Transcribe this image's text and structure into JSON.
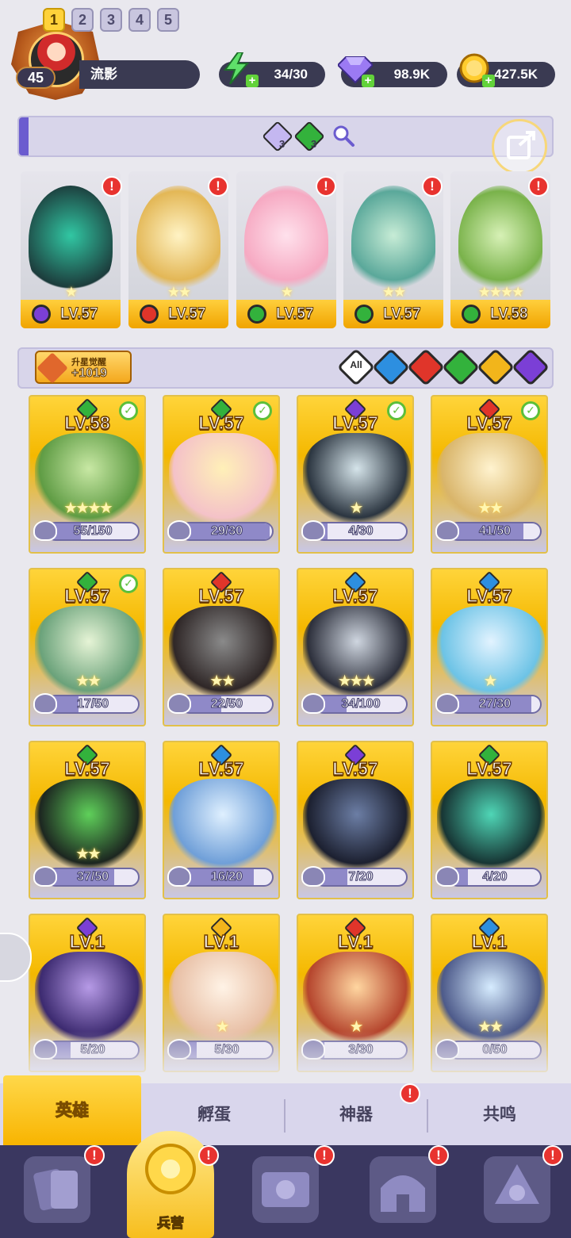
{
  "player": {
    "level": "45",
    "name": "流影"
  },
  "resources": {
    "energy": "34/30",
    "gems": "98.9K",
    "gold": "427.5K"
  },
  "team_tabs": [
    "1",
    "2",
    "3",
    "4",
    "5"
  ],
  "team_tools": {
    "gem_purple_count": "3",
    "gem_green_count": "3"
  },
  "team_cards": [
    {
      "level": "LV.57",
      "element": "dark",
      "stars": "★"
    },
    {
      "level": "LV.57",
      "element": "fire",
      "stars": "★★"
    },
    {
      "level": "LV.57",
      "element": "nature",
      "stars": "★"
    },
    {
      "level": "LV.57",
      "element": "nature",
      "stars": "★★"
    },
    {
      "level": "LV.58",
      "element": "nature",
      "stars": "★★★★"
    }
  ],
  "filter": {
    "star_title": "升星觉醒",
    "star_value": "+1019",
    "all_label": "All",
    "elements": [
      "water",
      "fire",
      "nature",
      "light",
      "dark"
    ]
  },
  "colors": {
    "dark": "#7b3fd6",
    "fire": "#e0352a",
    "nature": "#33b23c",
    "water": "#2d8fe0",
    "light": "#f2b51b"
  },
  "heroes": [
    {
      "level": "LV.58",
      "element": "nature",
      "checked": true,
      "progress": "55/150",
      "ratio": 0.367,
      "stars": "★★★★"
    },
    {
      "level": "LV.57",
      "element": "nature",
      "checked": true,
      "progress": "29/30",
      "ratio": 0.967,
      "stars": ""
    },
    {
      "level": "LV.57",
      "element": "dark",
      "checked": true,
      "progress": "4/30",
      "ratio": 0.133,
      "stars": "★"
    },
    {
      "level": "LV.57",
      "element": "fire",
      "checked": true,
      "progress": "41/50",
      "ratio": 0.82,
      "stars": "★★"
    },
    {
      "level": "LV.57",
      "element": "nature",
      "checked": true,
      "progress": "17/50",
      "ratio": 0.34,
      "stars": "★★"
    },
    {
      "level": "LV.57",
      "element": "fire",
      "checked": false,
      "progress": "22/50",
      "ratio": 0.44,
      "stars": "★★"
    },
    {
      "level": "LV.57",
      "element": "water",
      "checked": false,
      "progress": "34/100",
      "ratio": 0.34,
      "stars": "★★★"
    },
    {
      "level": "LV.57",
      "element": "water",
      "checked": false,
      "progress": "27/30",
      "ratio": 0.9,
      "stars": "★"
    },
    {
      "level": "LV.57",
      "element": "nature",
      "checked": false,
      "progress": "37/50",
      "ratio": 0.74,
      "stars": "★★"
    },
    {
      "level": "LV.57",
      "element": "water",
      "checked": false,
      "progress": "16/20",
      "ratio": 0.8,
      "stars": ""
    },
    {
      "level": "LV.57",
      "element": "dark",
      "checked": false,
      "progress": "7/20",
      "ratio": 0.35,
      "stars": ""
    },
    {
      "level": "LV.57",
      "element": "nature",
      "checked": false,
      "progress": "4/20",
      "ratio": 0.2,
      "stars": ""
    },
    {
      "level": "LV.1",
      "element": "dark",
      "checked": false,
      "progress": "5/20",
      "ratio": 0.25,
      "stars": ""
    },
    {
      "level": "LV.1",
      "element": "light",
      "checked": false,
      "progress": "5/30",
      "ratio": 0.167,
      "stars": "★"
    },
    {
      "level": "LV.1",
      "element": "fire",
      "checked": false,
      "progress": "3/30",
      "ratio": 0.1,
      "stars": "★"
    },
    {
      "level": "LV.1",
      "element": "water",
      "checked": false,
      "progress": "0/50",
      "ratio": 0.0,
      "stars": "★★"
    }
  ],
  "subtabs": {
    "heroes": "英雄",
    "hatch": "孵蛋",
    "artifact": "神器",
    "resonance": "共鸣"
  },
  "bottom_nav": {
    "barracks": "兵营"
  },
  "alert_mark": "!"
}
